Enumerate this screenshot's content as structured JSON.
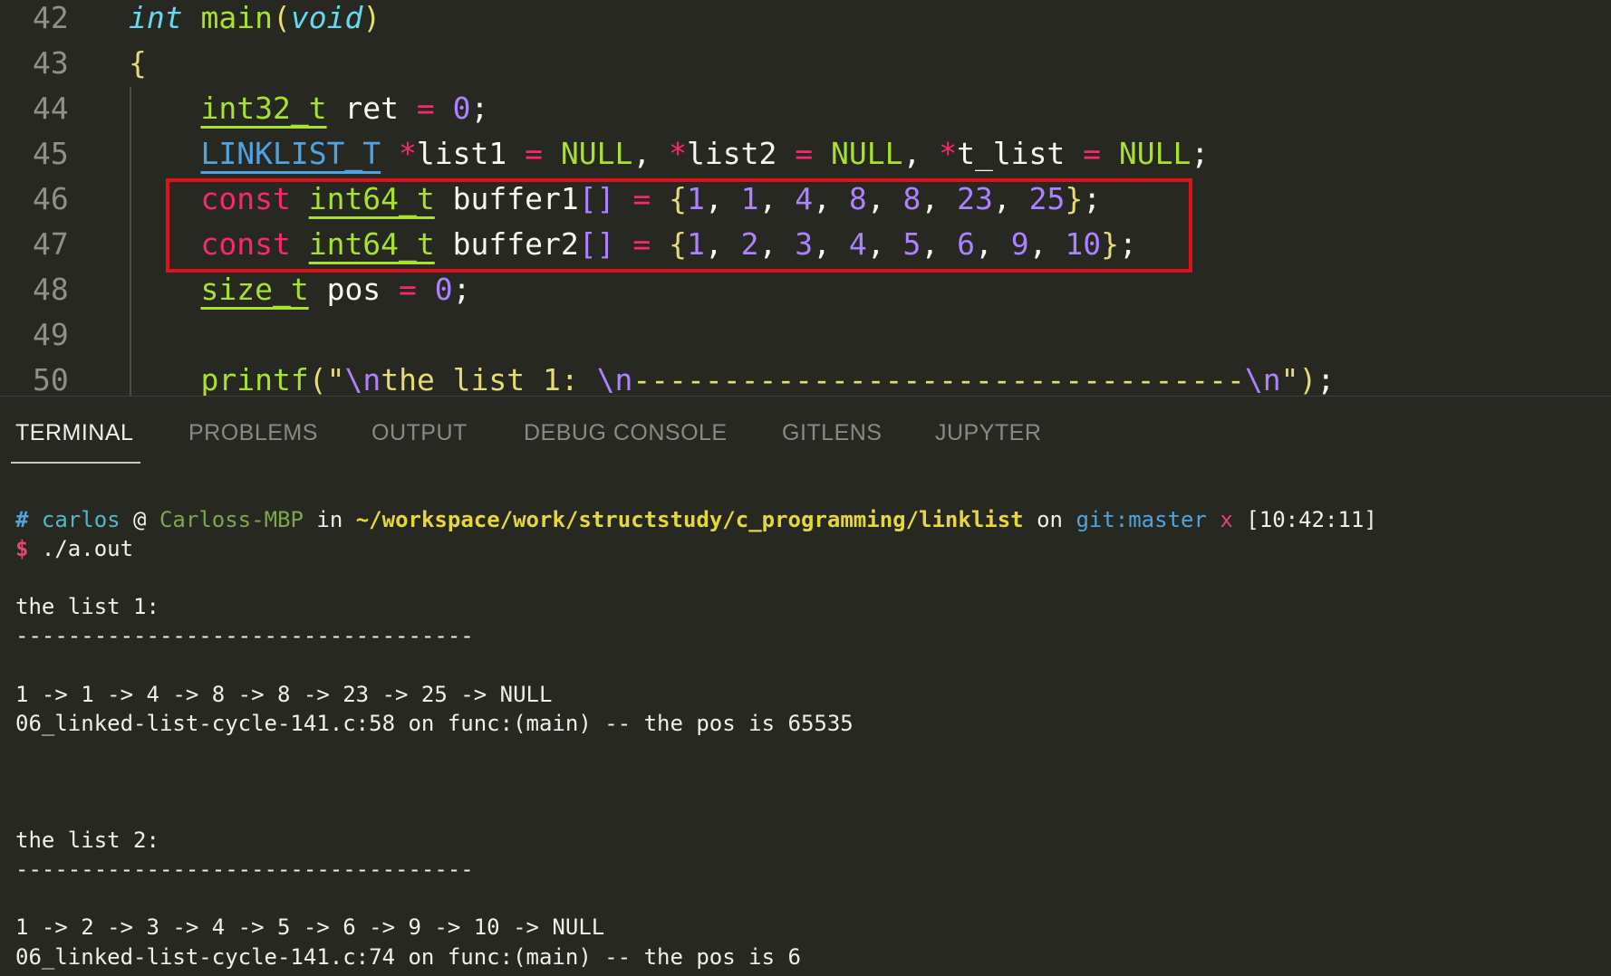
{
  "editor": {
    "lines": [
      {
        "num": "42",
        "tokens": [
          {
            "t": "int",
            "c": "k-type-it"
          },
          {
            "t": " "
          },
          {
            "t": "main",
            "c": "k-fn"
          },
          {
            "t": "(",
            "c": "k-brace"
          },
          {
            "t": "void",
            "c": "k-type-it"
          },
          {
            "t": ")",
            "c": "k-brace"
          }
        ]
      },
      {
        "num": "43",
        "tokens": [
          {
            "t": "{",
            "c": "k-brace"
          }
        ]
      },
      {
        "num": "44",
        "tokens": [
          {
            "t": "    "
          },
          {
            "t": "int32_t",
            "c": "k-type-u"
          },
          {
            "t": " ret "
          },
          {
            "t": "=",
            "c": "k-op"
          },
          {
            "t": " "
          },
          {
            "t": "0",
            "c": "k-num"
          },
          {
            "t": ";"
          }
        ]
      },
      {
        "num": "45",
        "tokens": [
          {
            "t": "    "
          },
          {
            "t": "LINKLIST_T",
            "c": "k-type-blue"
          },
          {
            "t": " "
          },
          {
            "t": "*",
            "c": "k-op"
          },
          {
            "t": "list1 "
          },
          {
            "t": "=",
            "c": "k-op"
          },
          {
            "t": " "
          },
          {
            "t": "NULL",
            "c": "k-const"
          },
          {
            "t": ", "
          },
          {
            "t": "*",
            "c": "k-op"
          },
          {
            "t": "list2 "
          },
          {
            "t": "=",
            "c": "k-op"
          },
          {
            "t": " "
          },
          {
            "t": "NULL",
            "c": "k-const"
          },
          {
            "t": ", "
          },
          {
            "t": "*",
            "c": "k-op"
          },
          {
            "t": "t_list "
          },
          {
            "t": "=",
            "c": "k-op"
          },
          {
            "t": " "
          },
          {
            "t": "NULL",
            "c": "k-const"
          },
          {
            "t": ";"
          }
        ]
      },
      {
        "num": "46",
        "tokens": [
          {
            "t": "    "
          },
          {
            "t": "const",
            "c": "k-kw"
          },
          {
            "t": " "
          },
          {
            "t": "int64_t",
            "c": "k-type-u"
          },
          {
            "t": " buffer1"
          },
          {
            "t": "[]",
            "c": "k-punc-p"
          },
          {
            "t": " "
          },
          {
            "t": "=",
            "c": "k-op"
          },
          {
            "t": " "
          },
          {
            "t": "{",
            "c": "k-brace"
          },
          {
            "t": "1",
            "c": "k-num"
          },
          {
            "t": ", "
          },
          {
            "t": "1",
            "c": "k-num"
          },
          {
            "t": ", "
          },
          {
            "t": "4",
            "c": "k-num"
          },
          {
            "t": ", "
          },
          {
            "t": "8",
            "c": "k-num"
          },
          {
            "t": ", "
          },
          {
            "t": "8",
            "c": "k-num"
          },
          {
            "t": ", "
          },
          {
            "t": "23",
            "c": "k-num"
          },
          {
            "t": ", "
          },
          {
            "t": "25",
            "c": "k-num"
          },
          {
            "t": "}",
            "c": "k-brace"
          },
          {
            "t": ";"
          }
        ]
      },
      {
        "num": "47",
        "tokens": [
          {
            "t": "    "
          },
          {
            "t": "const",
            "c": "k-kw"
          },
          {
            "t": " "
          },
          {
            "t": "int64_t",
            "c": "k-type-u"
          },
          {
            "t": " buffer2"
          },
          {
            "t": "[]",
            "c": "k-punc-p"
          },
          {
            "t": " "
          },
          {
            "t": "=",
            "c": "k-op"
          },
          {
            "t": " "
          },
          {
            "t": "{",
            "c": "k-brace"
          },
          {
            "t": "1",
            "c": "k-num"
          },
          {
            "t": ", "
          },
          {
            "t": "2",
            "c": "k-num"
          },
          {
            "t": ", "
          },
          {
            "t": "3",
            "c": "k-num"
          },
          {
            "t": ", "
          },
          {
            "t": "4",
            "c": "k-num"
          },
          {
            "t": ", "
          },
          {
            "t": "5",
            "c": "k-num"
          },
          {
            "t": ", "
          },
          {
            "t": "6",
            "c": "k-num"
          },
          {
            "t": ", "
          },
          {
            "t": "9",
            "c": "k-num"
          },
          {
            "t": ", "
          },
          {
            "t": "10",
            "c": "k-num"
          },
          {
            "t": "}",
            "c": "k-brace"
          },
          {
            "t": ";"
          }
        ]
      },
      {
        "num": "48",
        "tokens": [
          {
            "t": "    "
          },
          {
            "t": "size_t",
            "c": "k-type-u"
          },
          {
            "t": " pos "
          },
          {
            "t": "=",
            "c": "k-op"
          },
          {
            "t": " "
          },
          {
            "t": "0",
            "c": "k-num"
          },
          {
            "t": ";"
          }
        ]
      },
      {
        "num": "49",
        "tokens": []
      },
      {
        "num": "50",
        "tokens": [
          {
            "t": "    "
          },
          {
            "t": "printf",
            "c": "k-fn"
          },
          {
            "t": "(",
            "c": "k-brace"
          },
          {
            "t": "\"",
            "c": "k-str"
          },
          {
            "t": "\\n",
            "c": "k-punc-p"
          },
          {
            "t": "the list 1: ",
            "c": "k-str"
          },
          {
            "t": "\\n",
            "c": "k-punc-p"
          },
          {
            "t": "----------------------------------",
            "c": "k-str"
          },
          {
            "t": "\\n",
            "c": "k-punc-p"
          },
          {
            "t": "\"",
            "c": "k-str"
          },
          {
            "t": ")",
            "c": "k-brace"
          },
          {
            "t": ";"
          }
        ]
      }
    ]
  },
  "panel": {
    "tabs": [
      {
        "label": "TERMINAL",
        "active": true
      },
      {
        "label": "PROBLEMS",
        "active": false
      },
      {
        "label": "OUTPUT",
        "active": false
      },
      {
        "label": "DEBUG CONSOLE",
        "active": false
      },
      {
        "label": "GITLENS",
        "active": false
      },
      {
        "label": "JUPYTER",
        "active": false
      }
    ]
  },
  "terminal": {
    "prompt": {
      "hash": "#",
      "user": "carlos",
      "at": " @ ",
      "host": "Carloss-MBP",
      "in": " in ",
      "path": "~/workspace/work/structstudy/c_programming/linklist",
      "on": " on ",
      "git": "git:master",
      "x": "x",
      "time": "[10:42:11]"
    },
    "command": {
      "dollar": "$",
      "cmd": " ./a.out"
    },
    "output": [
      "",
      "the list 1:",
      "-----------------------------------",
      "",
      "1 -> 1 -> 4 -> 8 -> 8 -> 23 -> 25 -> NULL",
      "06_linked-list-cycle-141.c:58 on func:(main) -- the pos is 65535",
      "",
      "",
      "",
      "the list 2:",
      "-----------------------------------",
      "",
      "1 -> 2 -> 3 -> 4 -> 5 -> 6 -> 9 -> 10 -> NULL",
      "06_linked-list-cycle-141.c:74 on func:(main) -- the pos is 6"
    ]
  }
}
